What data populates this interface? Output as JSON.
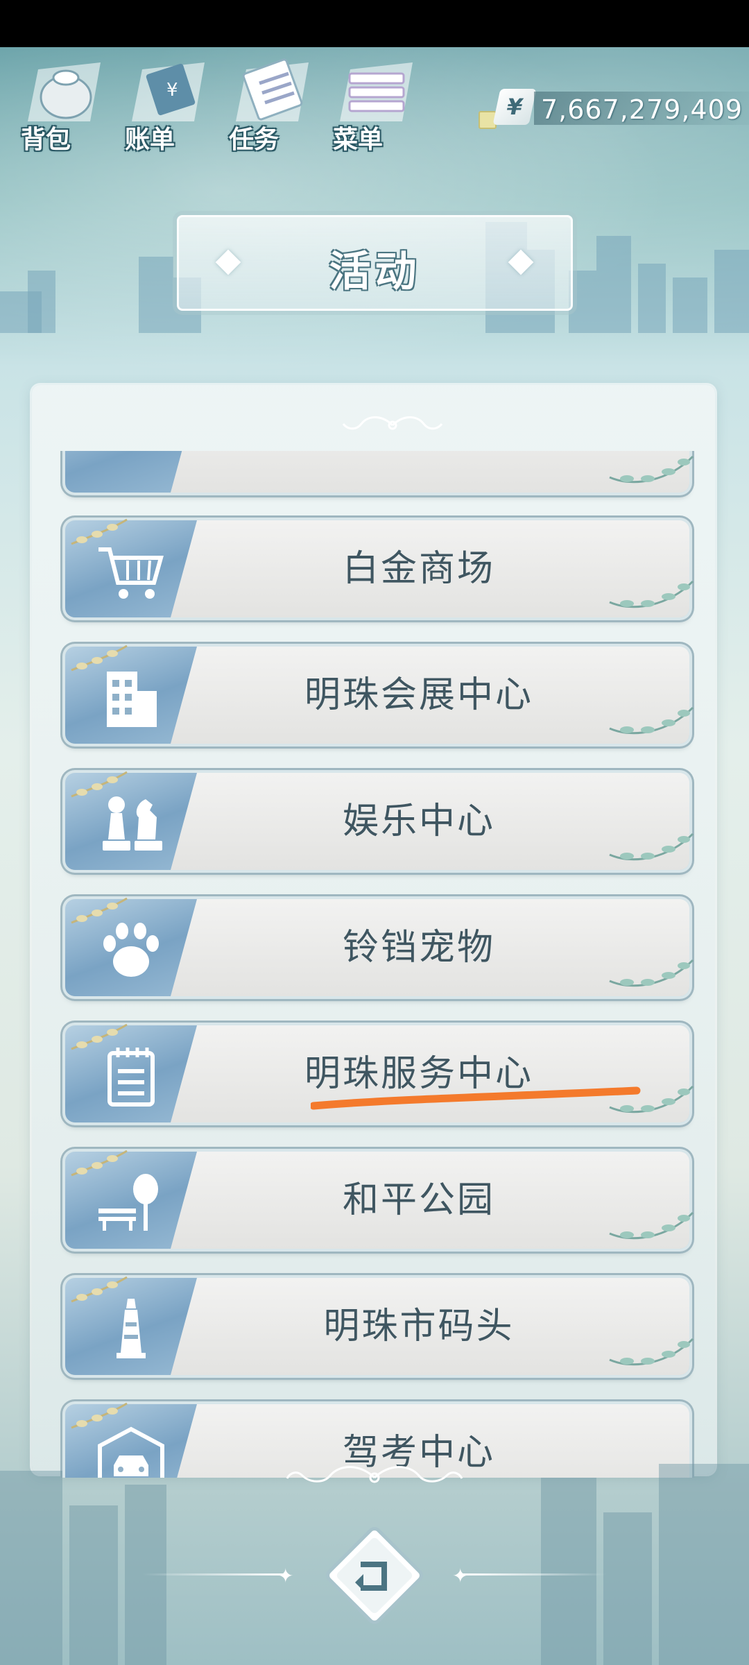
{
  "topnav": {
    "bag": "背包",
    "bill": "账单",
    "task": "任务",
    "menu": "菜单"
  },
  "currency": {
    "symbol": "¥",
    "amount": "7,667,279,409"
  },
  "title": "活动",
  "activities": [
    {
      "label": "",
      "icon": "partial-hidden-icon"
    },
    {
      "label": "白金商场",
      "icon": "shopping-cart-icon"
    },
    {
      "label": "明珠会展中心",
      "icon": "building-icon"
    },
    {
      "label": "娱乐中心",
      "icon": "chess-pieces-icon"
    },
    {
      "label": "铃铛宠物",
      "icon": "paw-icon"
    },
    {
      "label": "明珠服务中心",
      "icon": "notepad-icon"
    },
    {
      "label": "和平公园",
      "icon": "park-bench-tree-icon"
    },
    {
      "label": "明珠市码头",
      "icon": "lighthouse-icon"
    },
    {
      "label": "驾考中心",
      "icon": "garage-car-icon"
    }
  ],
  "colors": {
    "underline": "#f47a2c",
    "label": "#3f5661"
  }
}
